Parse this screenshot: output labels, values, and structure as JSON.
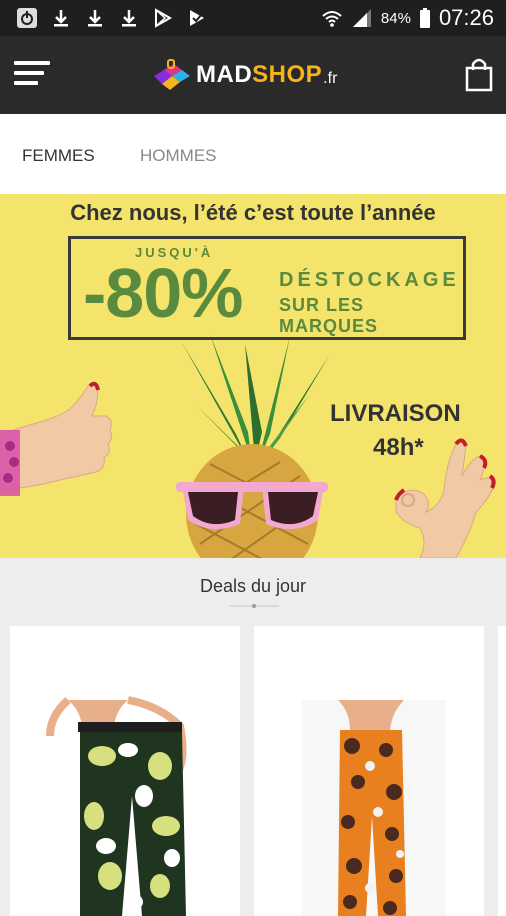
{
  "status_bar": {
    "battery": "84%",
    "time": "07:26"
  },
  "app_bar": {
    "logo_part1": "MAD",
    "logo_part2": "SHOP",
    "logo_tld": ".fr"
  },
  "tabs": [
    {
      "label": "FEMMES",
      "active": true
    },
    {
      "label": "HOMMES",
      "active": false
    }
  ],
  "banner": {
    "headline": "Chez nous, l’été c’est toute l’année",
    "upto": "JUSQU'À",
    "discount": "-80%",
    "line1": "DÉSTOCKAGE",
    "line2": "SUR LES MARQUES",
    "delivery1": "LIVRAISON",
    "delivery2": "48h*"
  },
  "deals": {
    "title": "Deals du jour"
  },
  "colors": {
    "app_bar": "#2a2a2a",
    "brand_accent": "#f4b41a",
    "banner_bg": "#f5e46c",
    "promo_green": "#5a8a3e"
  }
}
